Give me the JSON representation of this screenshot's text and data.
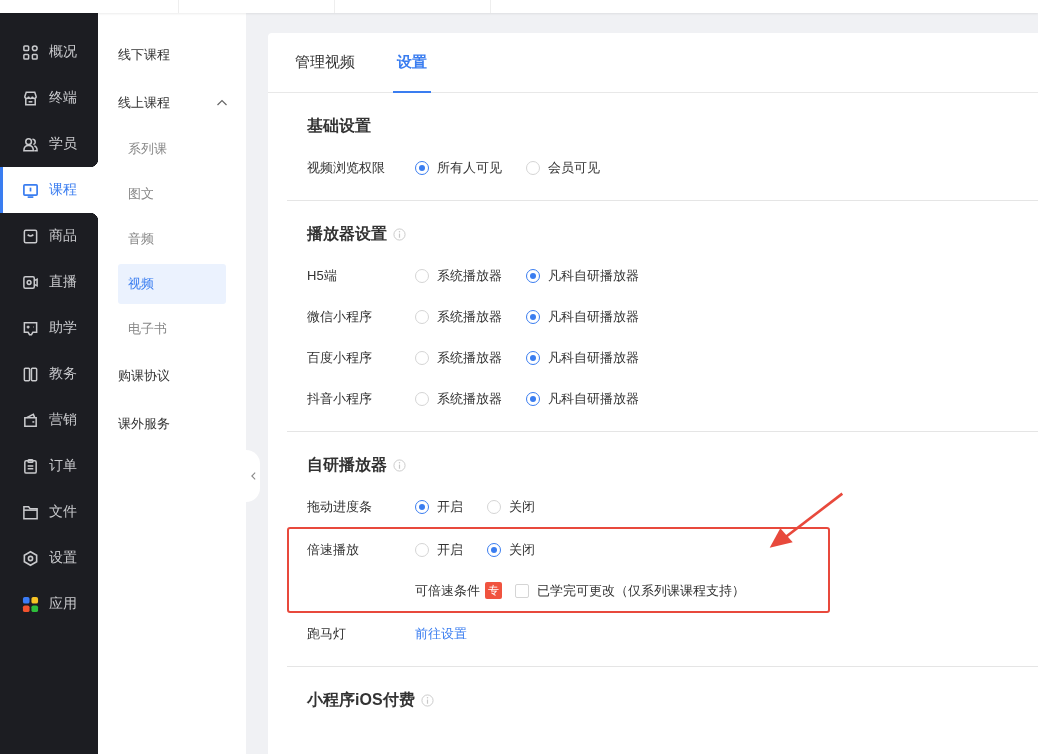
{
  "nav": [
    {
      "label": "概况",
      "selected": false
    },
    {
      "label": "终端",
      "selected": false
    },
    {
      "label": "学员",
      "selected": false
    },
    {
      "label": "课程",
      "selected": true
    },
    {
      "label": "商品",
      "selected": false
    },
    {
      "label": "直播",
      "selected": false
    },
    {
      "label": "助学",
      "selected": false
    },
    {
      "label": "教务",
      "selected": false
    },
    {
      "label": "营销",
      "selected": false
    },
    {
      "label": "订单",
      "selected": false
    },
    {
      "label": "文件",
      "selected": false
    },
    {
      "label": "设置",
      "selected": false
    },
    {
      "label": "应用",
      "selected": false
    }
  ],
  "submenu": [
    {
      "label": "线下课程",
      "selected": false
    },
    {
      "label": "线上课程",
      "selected": false,
      "expanded": true,
      "children": [
        {
          "label": "系列课",
          "selected": false
        },
        {
          "label": "图文",
          "selected": false
        },
        {
          "label": "音频",
          "selected": false
        },
        {
          "label": "视频",
          "selected": true
        },
        {
          "label": "电子书",
          "selected": false
        }
      ]
    },
    {
      "label": "购课协议",
      "selected": false
    },
    {
      "label": "课外服务",
      "selected": false
    }
  ],
  "tabs": [
    {
      "label": "管理视频",
      "selected": false
    },
    {
      "label": "设置",
      "selected": true
    }
  ],
  "sections": [
    {
      "title": "基础设置",
      "info": false,
      "rows": [
        {
          "kind": "radio",
          "label": "视频浏览权限",
          "options": [
            {
              "label": "所有人可见",
              "selected": true
            },
            {
              "label": "会员可见",
              "selected": false
            }
          ]
        }
      ]
    },
    {
      "title": "播放器设置",
      "info": true,
      "rows": [
        {
          "kind": "radio",
          "label": "H5端",
          "options": [
            {
              "label": "系统播放器",
              "selected": false
            },
            {
              "label": "凡科自研播放器",
              "selected": true
            }
          ]
        },
        {
          "kind": "radio",
          "label": "微信小程序",
          "options": [
            {
              "label": "系统播放器",
              "selected": false
            },
            {
              "label": "凡科自研播放器",
              "selected": true
            }
          ]
        },
        {
          "kind": "radio",
          "label": "百度小程序",
          "options": [
            {
              "label": "系统播放器",
              "selected": false
            },
            {
              "label": "凡科自研播放器",
              "selected": true
            }
          ]
        },
        {
          "kind": "radio",
          "label": "抖音小程序",
          "options": [
            {
              "label": "系统播放器",
              "selected": false
            },
            {
              "label": "凡科自研播放器",
              "selected": true
            }
          ]
        }
      ]
    },
    {
      "title": "自研播放器",
      "info": true,
      "rows": [
        {
          "kind": "radio",
          "label": "拖动进度条",
          "options": [
            {
              "label": "开启",
              "selected": true
            },
            {
              "label": "关闭",
              "selected": false
            }
          ]
        },
        {
          "kind": "radio",
          "label": "倍速播放",
          "highlighted": true,
          "options": [
            {
              "label": "开启",
              "selected": false
            },
            {
              "label": "关闭",
              "selected": true
            }
          ]
        },
        {
          "kind": "checkbox",
          "highlighted": true,
          "label": "可倍速条件",
          "badge": "专",
          "checkbox": {
            "label": "已学完可更改（仅系列课课程支持）",
            "checked": false
          }
        },
        {
          "kind": "link",
          "label": "跑马灯",
          "link": "前往设置"
        }
      ]
    },
    {
      "title": "小程序iOS付费",
      "info": true
    }
  ]
}
